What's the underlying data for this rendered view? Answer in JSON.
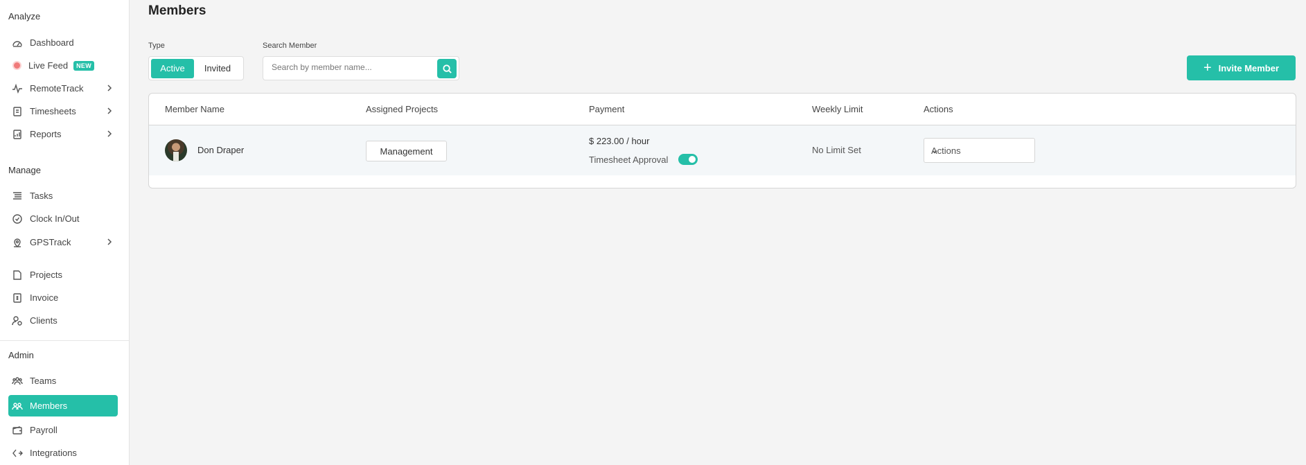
{
  "sidebar": {
    "sections": {
      "analyze": "Analyze",
      "manage": "Manage",
      "admin": "Admin"
    },
    "items": {
      "dashboard": "Dashboard",
      "live_feed": "Live Feed",
      "live_feed_badge": "NEW",
      "remotetrack": "RemoteTrack",
      "timesheets": "Timesheets",
      "reports": "Reports",
      "tasks": "Tasks",
      "clock": "Clock In/Out",
      "gpstrack": "GPSTrack",
      "projects": "Projects",
      "invoice": "Invoice",
      "clients": "Clients",
      "teams": "Teams",
      "members": "Members",
      "payroll": "Payroll",
      "integrations": "Integrations"
    },
    "active_item": "members"
  },
  "header": {
    "title": "Members"
  },
  "filters": {
    "type_label": "Type",
    "type_options": [
      "Active",
      "Invited"
    ],
    "type_selected": "Active",
    "search_label": "Search Member",
    "search_placeholder": "Search by member name...",
    "search_value": ""
  },
  "invite_button": {
    "label": "Invite Member"
  },
  "table": {
    "columns": [
      "Member Name",
      "Assigned Projects",
      "Payment",
      "Weekly Limit",
      "Actions"
    ],
    "rows": [
      {
        "name": "Don Draper",
        "project": "Management",
        "payment": "$ 223.00 / hour",
        "timesheet_label": "Timesheet Approval",
        "timesheet_approval": true,
        "weekly_limit": "No Limit Set",
        "actions": "Actions"
      }
    ]
  },
  "colors": {
    "accent": "#25bfa8",
    "live_dot": "#f07a7a",
    "background": "#f4f4f4"
  },
  "icons": {
    "dashboard": "gauge-icon",
    "remotetrack": "pulse-icon",
    "timesheets": "clipboard-icon",
    "reports": "report-icon",
    "tasks": "list-icon",
    "clock": "clock-check-icon",
    "gpstrack": "map-pin-icon",
    "projects": "folder-icon",
    "invoice": "invoice-icon",
    "clients": "client-icon",
    "teams": "team-icon",
    "members": "members-icon",
    "payroll": "wallet-icon",
    "integrations": "integrations-icon"
  }
}
